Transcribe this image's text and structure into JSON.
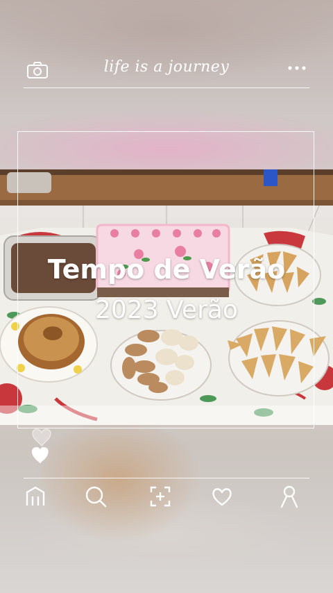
{
  "header": {
    "title": "life is a journey",
    "camera_icon": "camera-icon",
    "more_icon": "more-dots-icon"
  },
  "post": {
    "caption_title": "Tempo de Verão",
    "caption_subtitle": "2023 Verão"
  },
  "reactions": {
    "icons": [
      "heart-outline-icon",
      "heart-filled-icon"
    ]
  },
  "bottom_nav": {
    "items": [
      {
        "icon": "home-icon"
      },
      {
        "icon": "search-icon"
      },
      {
        "icon": "add-scan-icon"
      },
      {
        "icon": "heart-icon"
      },
      {
        "icon": "profile-icon"
      }
    ]
  },
  "colors": {
    "overlay_text": "#ffffff",
    "accent_pink": "#e3b3c8"
  }
}
